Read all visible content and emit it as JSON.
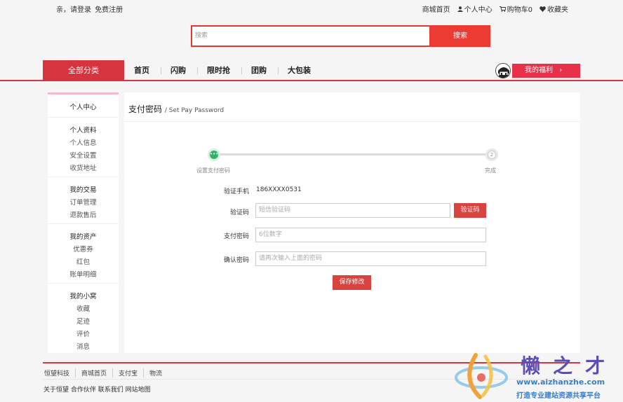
{
  "topbar": {
    "greeting": "亲，请登录",
    "register": "免费注册",
    "mall_home": "商城首页",
    "user_center": "个人中心",
    "cart": "购物车0",
    "favorites": "收藏夹"
  },
  "search": {
    "placeholder": "搜索",
    "button": "搜索"
  },
  "nav": {
    "all_categories": "全部分类",
    "items": [
      "首页",
      "闪购",
      "限时抢",
      "团购",
      "大包装"
    ],
    "welfare": "我的福利"
  },
  "sidebar": {
    "header": "个人中心",
    "groups": [
      {
        "title": "个人资料",
        "items": [
          "个人信息",
          "安全设置",
          "收货地址"
        ]
      },
      {
        "title": "我的交易",
        "items": [
          "订单管理",
          "退款售后"
        ]
      },
      {
        "title": "我的资产",
        "items": [
          "优惠券",
          "红包",
          "账单明细"
        ]
      },
      {
        "title": "我的小窝",
        "items": [
          "收藏",
          "足迹",
          "评价",
          "消息"
        ]
      }
    ]
  },
  "main": {
    "title": "支付密码",
    "subtitle": "/ Set Pay Password",
    "steps": [
      {
        "marker": "•••",
        "label": "设置支付密码"
      },
      {
        "marker": "2",
        "label": "完成"
      }
    ],
    "form": {
      "phone_label": "验证手机",
      "phone_value": "186XXXX0531",
      "code_label": "验证码",
      "code_placeholder": "短信验证码",
      "code_button": "验证码",
      "password_label": "支付密码",
      "password_placeholder": "6位数字",
      "confirm_label": "确认密码",
      "confirm_placeholder": "请再次输入上面的密码",
      "save_button": "保存修改"
    }
  },
  "footer": {
    "links": [
      "恒望科技",
      "商城首页",
      "支付宝",
      "物流"
    ],
    "bottom": "关于恒望 合作伙伴 联系我们 网站地图"
  },
  "watermark": {
    "brand": "懒之才",
    "url": "www.aizhanzhe.com",
    "slogan": "打造专业建站资源共享平台"
  },
  "colors": {
    "accent": "#d6343f",
    "search": "#ec3b33",
    "step_active": "#2fb36a"
  }
}
